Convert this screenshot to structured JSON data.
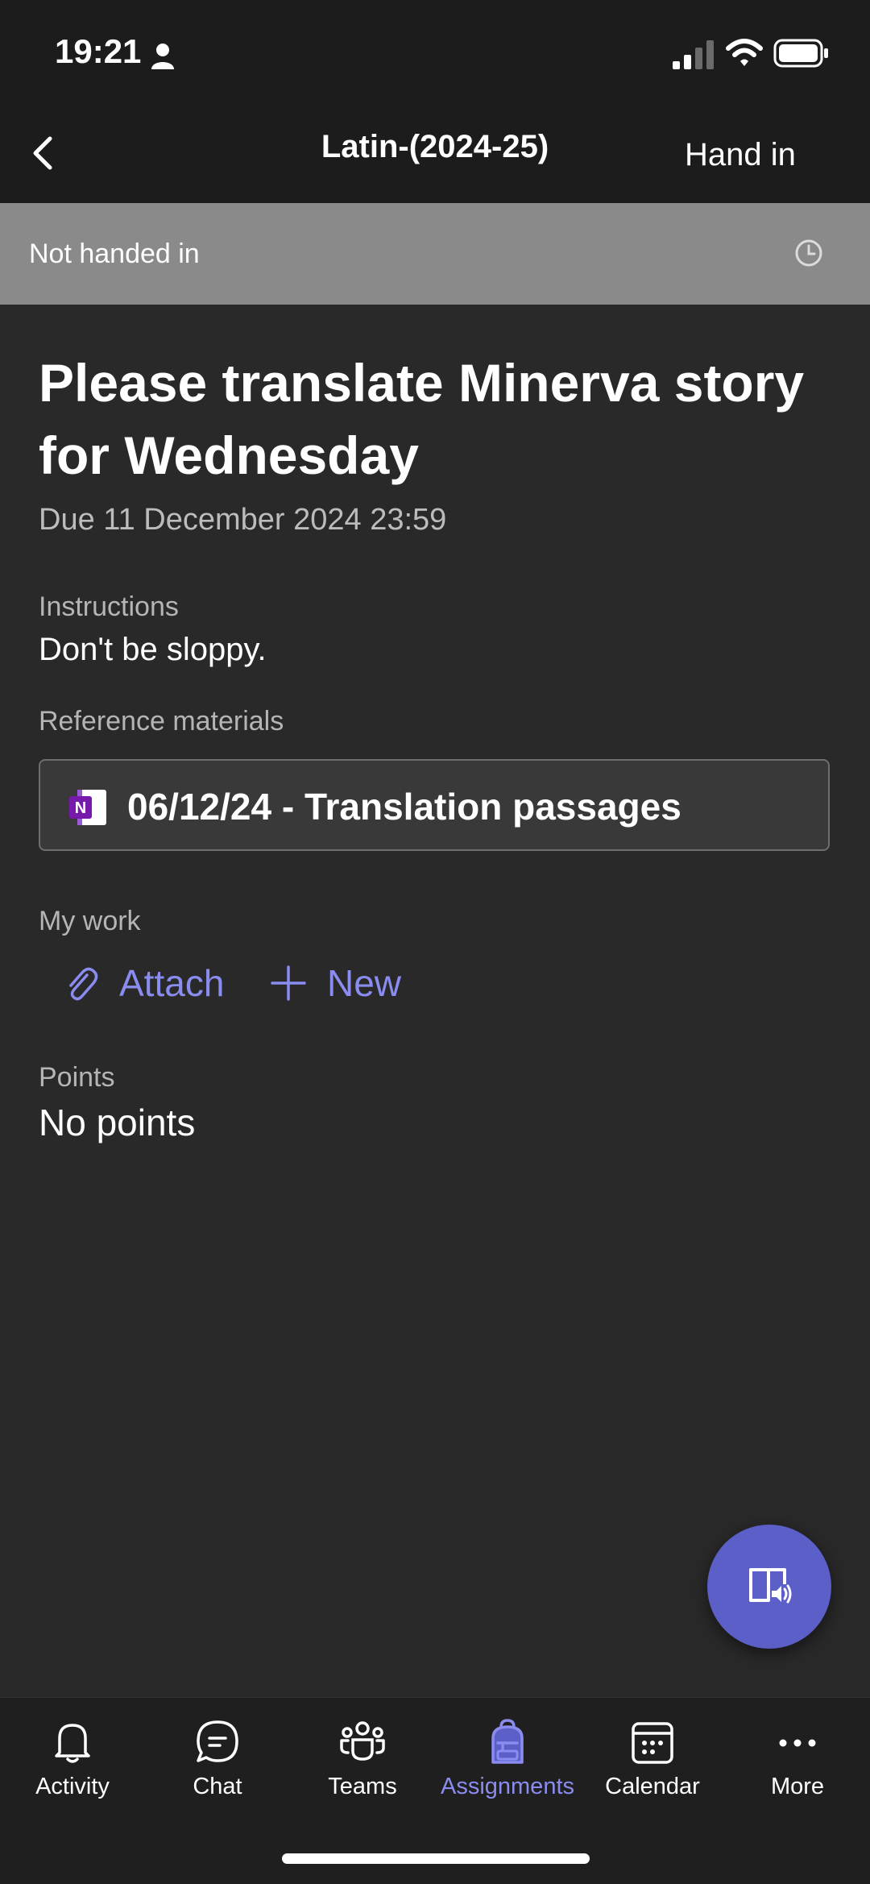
{
  "status_bar": {
    "time": "19:21"
  },
  "nav": {
    "title": "Latin-(2024-25)",
    "hand_in_label": "Hand in"
  },
  "status_strip": {
    "text": "Not handed in"
  },
  "assignment": {
    "title": "Please translate Minerva story for Wednesday",
    "due": "Due 11 December 2024 23:59",
    "instructions_label": "Instructions",
    "instructions": "Don't be sloppy.",
    "reference_label": "Reference materials",
    "reference_item": "06/12/24 - Translation passages",
    "my_work_label": "My work",
    "attach_label": "Attach",
    "new_label": "New",
    "points_label": "Points",
    "points_value": "No points"
  },
  "tabs": [
    {
      "label": "Activity",
      "icon": "bell-icon"
    },
    {
      "label": "Chat",
      "icon": "chat-icon"
    },
    {
      "label": "Teams",
      "icon": "teams-icon"
    },
    {
      "label": "Assignments",
      "icon": "backpack-icon",
      "active": true
    },
    {
      "label": "Calendar",
      "icon": "calendar-icon"
    },
    {
      "label": "More",
      "icon": "more-icon"
    }
  ],
  "colors": {
    "accent": "#8b8cf0",
    "fab": "#5b5fc7",
    "background": "#292929",
    "status_strip": "#8a8a8a"
  }
}
